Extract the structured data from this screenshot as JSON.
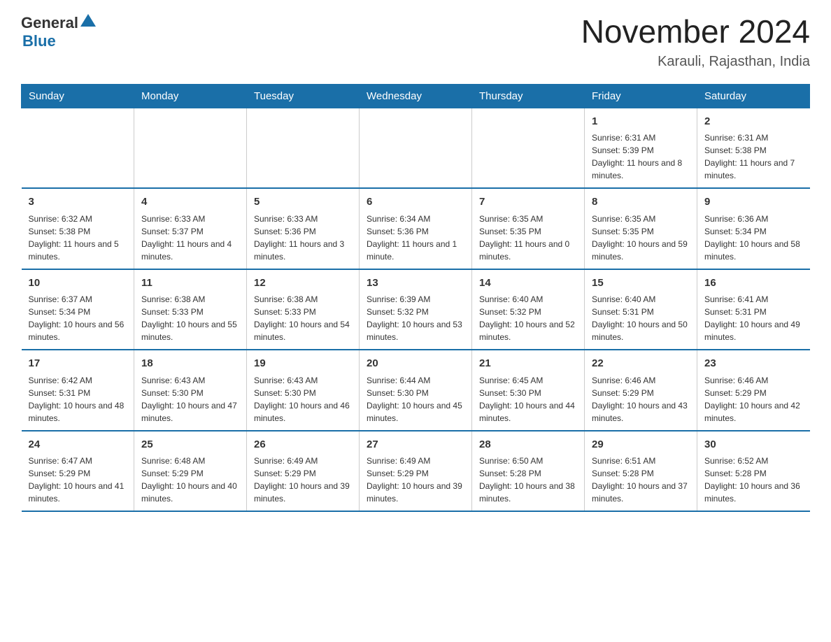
{
  "header": {
    "logo_general": "General",
    "logo_blue": "Blue",
    "title": "November 2024",
    "subtitle": "Karauli, Rajasthan, India"
  },
  "days_of_week": [
    "Sunday",
    "Monday",
    "Tuesday",
    "Wednesday",
    "Thursday",
    "Friday",
    "Saturday"
  ],
  "weeks": [
    [
      {
        "day": "",
        "info": ""
      },
      {
        "day": "",
        "info": ""
      },
      {
        "day": "",
        "info": ""
      },
      {
        "day": "",
        "info": ""
      },
      {
        "day": "",
        "info": ""
      },
      {
        "day": "1",
        "info": "Sunrise: 6:31 AM\nSunset: 5:39 PM\nDaylight: 11 hours and 8 minutes."
      },
      {
        "day": "2",
        "info": "Sunrise: 6:31 AM\nSunset: 5:38 PM\nDaylight: 11 hours and 7 minutes."
      }
    ],
    [
      {
        "day": "3",
        "info": "Sunrise: 6:32 AM\nSunset: 5:38 PM\nDaylight: 11 hours and 5 minutes."
      },
      {
        "day": "4",
        "info": "Sunrise: 6:33 AM\nSunset: 5:37 PM\nDaylight: 11 hours and 4 minutes."
      },
      {
        "day": "5",
        "info": "Sunrise: 6:33 AM\nSunset: 5:36 PM\nDaylight: 11 hours and 3 minutes."
      },
      {
        "day": "6",
        "info": "Sunrise: 6:34 AM\nSunset: 5:36 PM\nDaylight: 11 hours and 1 minute."
      },
      {
        "day": "7",
        "info": "Sunrise: 6:35 AM\nSunset: 5:35 PM\nDaylight: 11 hours and 0 minutes."
      },
      {
        "day": "8",
        "info": "Sunrise: 6:35 AM\nSunset: 5:35 PM\nDaylight: 10 hours and 59 minutes."
      },
      {
        "day": "9",
        "info": "Sunrise: 6:36 AM\nSunset: 5:34 PM\nDaylight: 10 hours and 58 minutes."
      }
    ],
    [
      {
        "day": "10",
        "info": "Sunrise: 6:37 AM\nSunset: 5:34 PM\nDaylight: 10 hours and 56 minutes."
      },
      {
        "day": "11",
        "info": "Sunrise: 6:38 AM\nSunset: 5:33 PM\nDaylight: 10 hours and 55 minutes."
      },
      {
        "day": "12",
        "info": "Sunrise: 6:38 AM\nSunset: 5:33 PM\nDaylight: 10 hours and 54 minutes."
      },
      {
        "day": "13",
        "info": "Sunrise: 6:39 AM\nSunset: 5:32 PM\nDaylight: 10 hours and 53 minutes."
      },
      {
        "day": "14",
        "info": "Sunrise: 6:40 AM\nSunset: 5:32 PM\nDaylight: 10 hours and 52 minutes."
      },
      {
        "day": "15",
        "info": "Sunrise: 6:40 AM\nSunset: 5:31 PM\nDaylight: 10 hours and 50 minutes."
      },
      {
        "day": "16",
        "info": "Sunrise: 6:41 AM\nSunset: 5:31 PM\nDaylight: 10 hours and 49 minutes."
      }
    ],
    [
      {
        "day": "17",
        "info": "Sunrise: 6:42 AM\nSunset: 5:31 PM\nDaylight: 10 hours and 48 minutes."
      },
      {
        "day": "18",
        "info": "Sunrise: 6:43 AM\nSunset: 5:30 PM\nDaylight: 10 hours and 47 minutes."
      },
      {
        "day": "19",
        "info": "Sunrise: 6:43 AM\nSunset: 5:30 PM\nDaylight: 10 hours and 46 minutes."
      },
      {
        "day": "20",
        "info": "Sunrise: 6:44 AM\nSunset: 5:30 PM\nDaylight: 10 hours and 45 minutes."
      },
      {
        "day": "21",
        "info": "Sunrise: 6:45 AM\nSunset: 5:30 PM\nDaylight: 10 hours and 44 minutes."
      },
      {
        "day": "22",
        "info": "Sunrise: 6:46 AM\nSunset: 5:29 PM\nDaylight: 10 hours and 43 minutes."
      },
      {
        "day": "23",
        "info": "Sunrise: 6:46 AM\nSunset: 5:29 PM\nDaylight: 10 hours and 42 minutes."
      }
    ],
    [
      {
        "day": "24",
        "info": "Sunrise: 6:47 AM\nSunset: 5:29 PM\nDaylight: 10 hours and 41 minutes."
      },
      {
        "day": "25",
        "info": "Sunrise: 6:48 AM\nSunset: 5:29 PM\nDaylight: 10 hours and 40 minutes."
      },
      {
        "day": "26",
        "info": "Sunrise: 6:49 AM\nSunset: 5:29 PM\nDaylight: 10 hours and 39 minutes."
      },
      {
        "day": "27",
        "info": "Sunrise: 6:49 AM\nSunset: 5:29 PM\nDaylight: 10 hours and 39 minutes."
      },
      {
        "day": "28",
        "info": "Sunrise: 6:50 AM\nSunset: 5:28 PM\nDaylight: 10 hours and 38 minutes."
      },
      {
        "day": "29",
        "info": "Sunrise: 6:51 AM\nSunset: 5:28 PM\nDaylight: 10 hours and 37 minutes."
      },
      {
        "day": "30",
        "info": "Sunrise: 6:52 AM\nSunset: 5:28 PM\nDaylight: 10 hours and 36 minutes."
      }
    ]
  ]
}
